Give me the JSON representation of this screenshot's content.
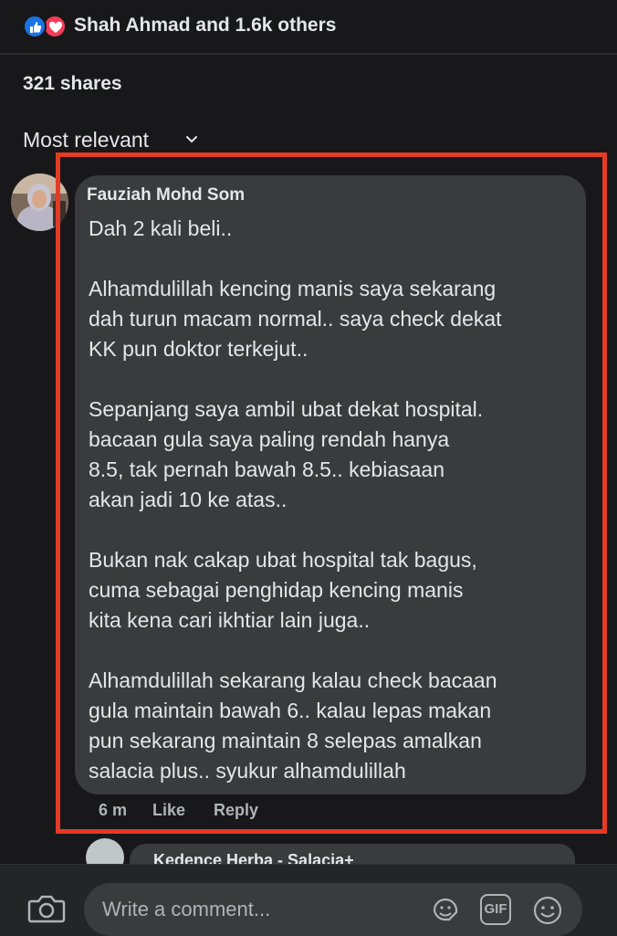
{
  "reactions": {
    "text": "Shah Ahmad and 1.6k others",
    "like_color": "#1b74e4",
    "love_color": "#f33e58"
  },
  "shares": "321 shares",
  "sort": {
    "label": "Most relevant",
    "icon": "chevron-down-icon"
  },
  "comment": {
    "author": "Fauziah Mohd Som",
    "paragraphs": [
      "Dah 2 kali beli..",
      "Alhamdulillah kencing manis saya sekarang\ndah turun macam normal.. saya check dekat\nKK pun doktor terkejut..",
      "Sepanjang saya ambil ubat dekat hospital.\nbacaan gula saya paling rendah hanya\n8.5, tak pernah bawah 8.5.. kebiasaan\nakan jadi 10 ke atas..",
      "Bukan nak cakap ubat hospital tak bagus,\ncuma sebagai penghidap kencing manis\nkita kena cari ikhtiar lain juga..",
      "Alhamdulillah sekarang kalau check bacaan\ngula maintain bawah 6.. kalau lepas makan\npun sekarang maintain 8 selepas amalkan\nsalacia plus.. syukur alhamdulillah"
    ],
    "time": "6 m",
    "like_label": "Like",
    "reply_label": "Reply"
  },
  "next_comment": {
    "author": "Kedence Herba - Salacia+"
  },
  "composer": {
    "placeholder": "Write a comment...",
    "gif_label": "GIF",
    "icons": [
      "camera-icon",
      "sticker-icon",
      "gif-icon",
      "emoji-icon"
    ]
  },
  "highlight_color": "#e53a25"
}
